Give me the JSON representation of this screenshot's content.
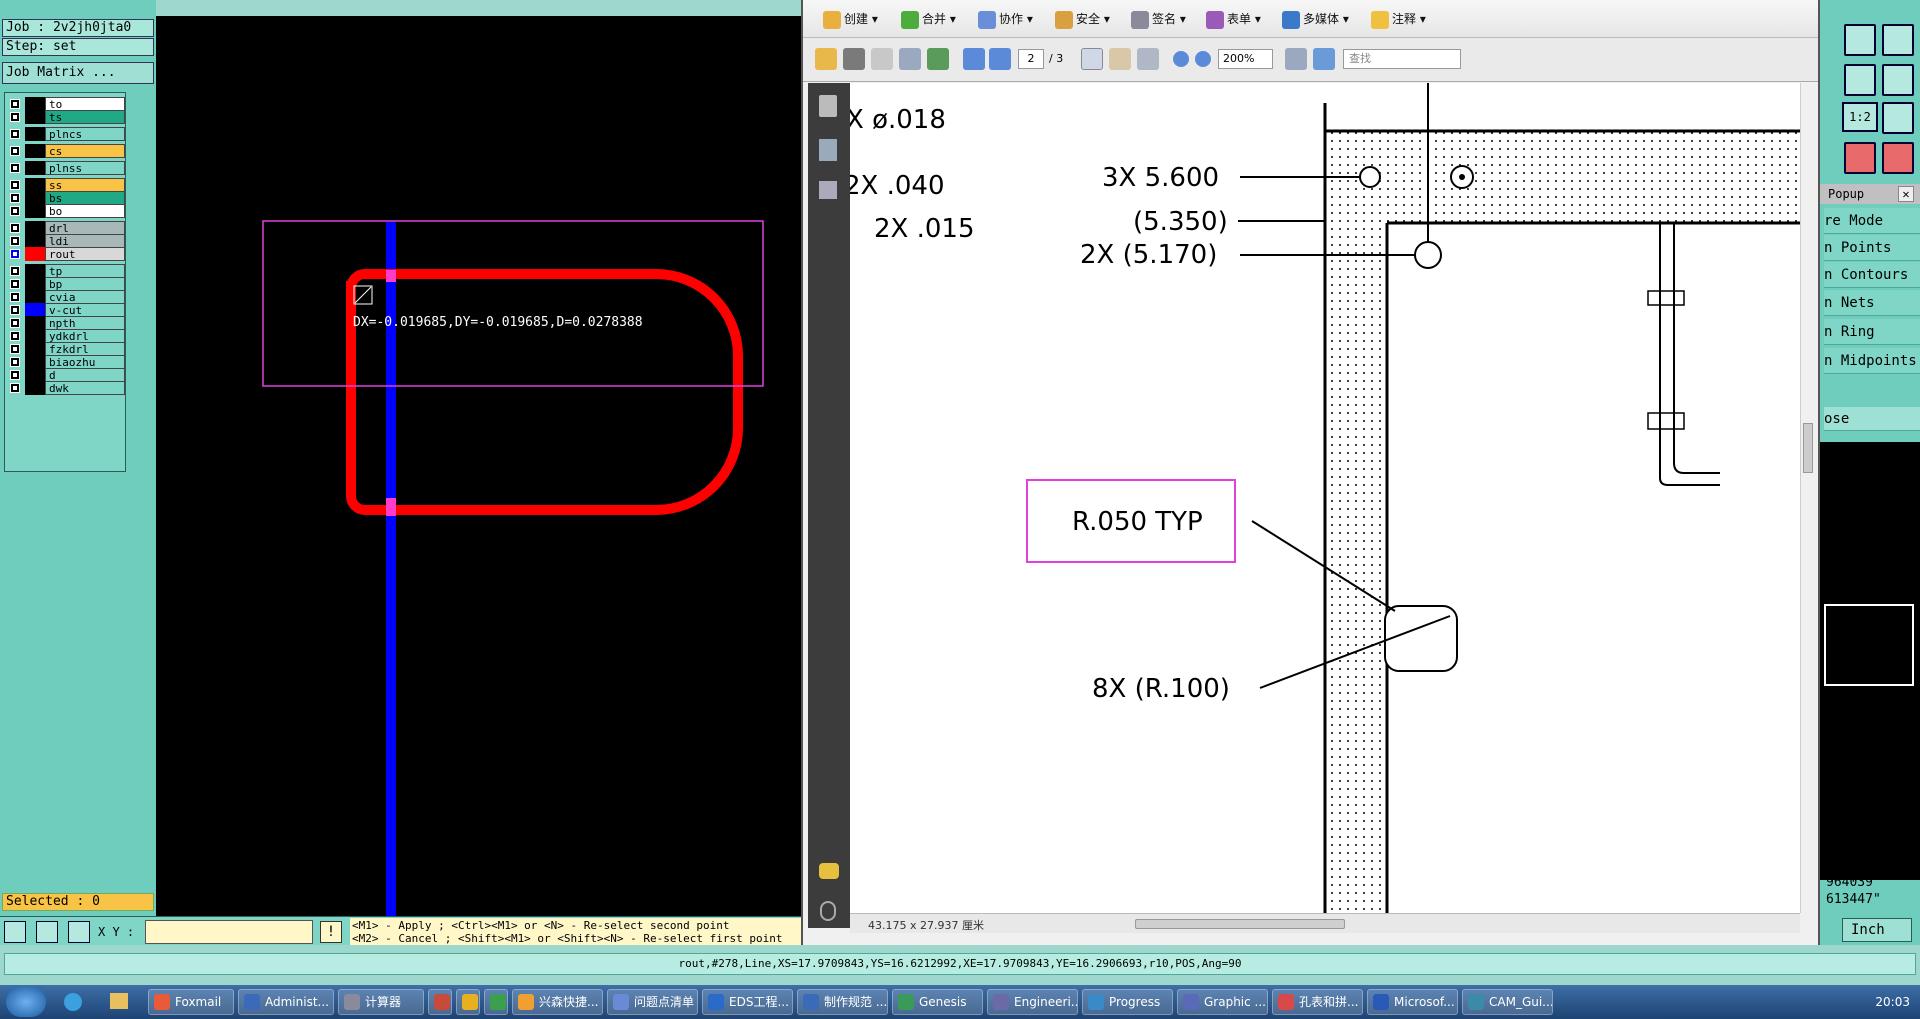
{
  "left_panel": {
    "job": "Job : 2v2jh0jta0",
    "step": "Step: set",
    "job_matrix": "Job Matrix ...",
    "selected": "Selected : 0",
    "layers": [
      {
        "name": "to",
        "color": "#ffffff"
      },
      {
        "name": "ts",
        "color": "#21a884"
      },
      {
        "name": "plncs",
        "color": "#7fd6c6"
      },
      {
        "name": "cs",
        "color": "#f9c445"
      },
      {
        "name": "plnss",
        "color": "#7fd6c6"
      },
      {
        "name": "ss",
        "color": "#f9c445"
      },
      {
        "name": "bs",
        "color": "#21a884"
      },
      {
        "name": "bo",
        "color": "#ffffff"
      },
      {
        "name": "drl",
        "color": "#a8b8b8"
      },
      {
        "name": "ldi",
        "color": "#a8b8b8"
      },
      {
        "name": "rout",
        "color": "#d8d8d8"
      },
      {
        "name": "tp",
        "color": "#7fd6c6"
      },
      {
        "name": "bp",
        "color": "#7fd6c6"
      },
      {
        "name": "cvia",
        "color": "#7fd6c6"
      },
      {
        "name": "v-cut",
        "color": "#7fd6c6"
      },
      {
        "name": "npth",
        "color": "#7fd6c6"
      },
      {
        "name": "ydkdrl",
        "color": "#7fd6c6"
      },
      {
        "name": "fzkdrl",
        "color": "#7fd6c6"
      },
      {
        "name": "biaozhu",
        "color": "#7fd6c6"
      },
      {
        "name": "d",
        "color": "#7fd6c6"
      },
      {
        "name": "dwk",
        "color": "#7fd6c6"
      }
    ]
  },
  "canvas": {
    "measure_text": "DX=-0.019685,DY=-0.019685,D=0.0278388",
    "colors": {
      "rout": "#ff0000",
      "vcut": "#0000ff",
      "box": "#e040e0"
    }
  },
  "pdf": {
    "toolbar": [
      "创建",
      "合并",
      "协作",
      "安全",
      "签名",
      "表单",
      "多媒体",
      "注释"
    ],
    "page_current": "2",
    "page_total": "/ 3",
    "zoom": "200%",
    "search_placeholder": "查找",
    "size_text": "43.175 x 27.937 厘米",
    "labels": {
      "dia018": "X  ø.018",
      "l040": "2X  .040",
      "l015": "2X  .015",
      "l5600": "3X  5.600",
      "l5350": "(5.350)",
      "l5170": "2X  (5.170)",
      "r050": "R.050  TYP",
      "r100": "8X  (R.100)"
    }
  },
  "right_panel": {
    "popup_title": "Popup",
    "menu": [
      "re Mode",
      "n Points",
      "n Contours",
      "n Nets",
      "n Ring",
      "n Midpoints"
    ],
    "close": "ose",
    "coord1": "964039\"",
    "coord2": "613447\"",
    "units": "Inch"
  },
  "bottom": {
    "xy_label": "X Y :",
    "hint1": "<M1> - Apply  ; <Ctrl><M1> or <N> - Re-select second point",
    "hint2": "<M2> - Cancel ; <Shift><M1> or <Shift><N> - Re-select first point",
    "status": "rout,#278,Line,XS=17.9709843,YS=16.6212992,XE=17.9709843,YE=16.2906693,r10,POS,Ang=90"
  },
  "taskbar": {
    "items": [
      "Foxmail",
      "Administ...",
      "计算器",
      "",
      "",
      "",
      "兴森快捷...",
      "问题点清单",
      "EDS工程...",
      "制作规范 ...",
      "Genesis",
      "Engineeri...",
      "Progress",
      "Graphic ...",
      "孔表和拼...",
      "Microsof...",
      "CAM_Gui..."
    ],
    "clock": "20:03"
  }
}
